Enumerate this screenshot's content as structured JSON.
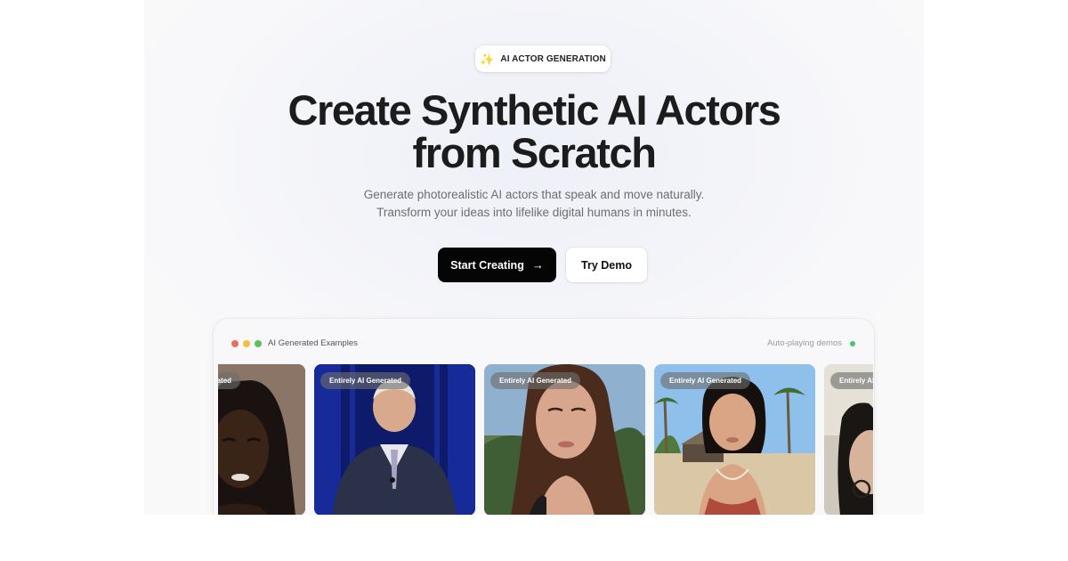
{
  "hero": {
    "badge_icon": "sparkles-icon",
    "badge_label": "AI ACTOR GENERATION",
    "title_line1": "Create Synthetic AI Actors",
    "title_line2": "from Scratch",
    "subtitle": "Generate photorealistic AI actors that speak and move naturally. Transform your ideas into lifelike digital humans in minutes.",
    "primary_cta": "Start Creating",
    "primary_cta_icon": "arrow-right-icon",
    "secondary_cta": "Try Demo"
  },
  "examples": {
    "title": "AI Generated Examples",
    "status": "Auto-playing demos",
    "status_color": "#44c76a",
    "window_dots": [
      "#ea6f5a",
      "#f2be3d",
      "#5ac25b"
    ],
    "cards": [
      {
        "tag": "Entirely AI Generated"
      },
      {
        "tag": "Entirely AI Generated"
      },
      {
        "tag": "Entirely AI Generated"
      },
      {
        "tag": "Entirely AI Generated"
      },
      {
        "tag": "Entirely AI Generated"
      }
    ]
  }
}
